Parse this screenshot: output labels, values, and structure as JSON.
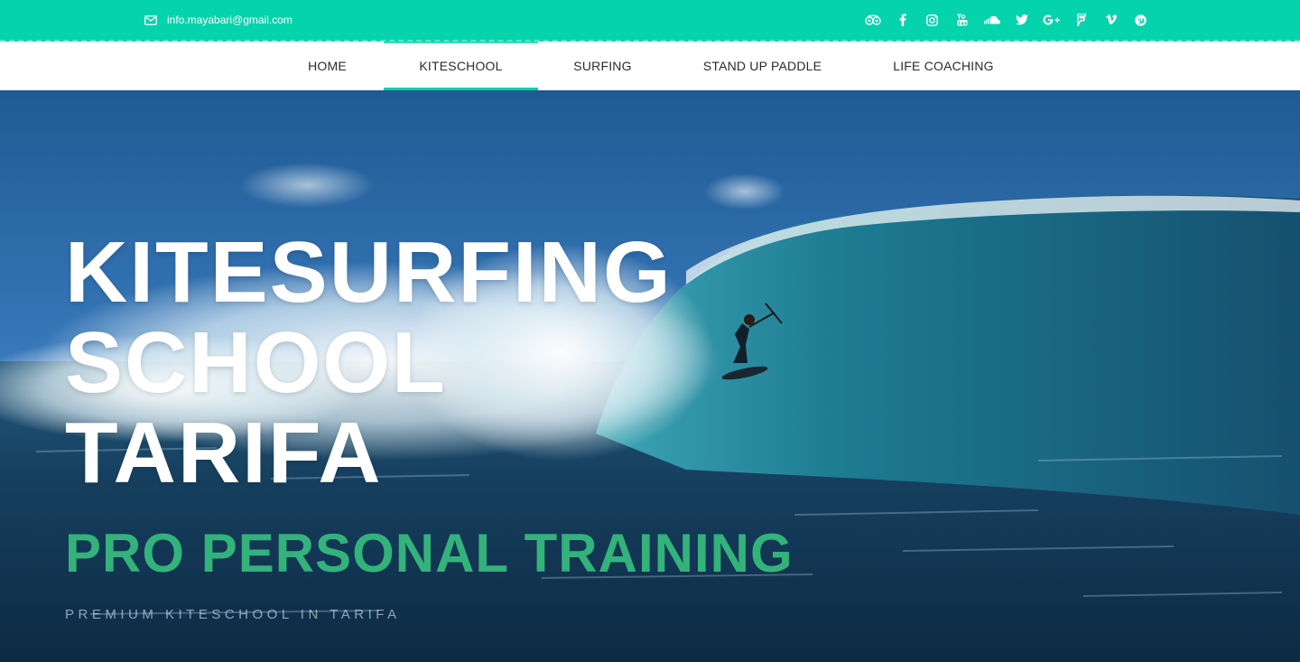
{
  "topbar": {
    "email": "info.mayabari@gmail.com",
    "email_icon": "envelope-icon",
    "social_icons": [
      "tripadvisor-icon",
      "facebook-icon",
      "instagram-icon",
      "youtube-icon",
      "soundcloud-icon",
      "twitter-icon",
      "google-plus-icon",
      "foursquare-icon",
      "vimeo-icon",
      "pinterest-icon"
    ],
    "color": "#04d3ac"
  },
  "nav": {
    "items": [
      {
        "label": "HOME"
      },
      {
        "label": "KITESCHOOL"
      },
      {
        "label": "SURFING"
      },
      {
        "label": "STAND UP PADDLE"
      },
      {
        "label": "LIFE COACHING"
      }
    ],
    "active": "KITESCHOOL",
    "accent": "#04d3ac"
  },
  "hero": {
    "title_lines": [
      "KITESURFING",
      "SCHOOL",
      "TARIFA"
    ],
    "subtitle": "PRO PERSONAL TRAINING",
    "subtitle_color": "#33b27b",
    "tagline": "PREMIUM KITESCHOOL IN TARIFA"
  }
}
